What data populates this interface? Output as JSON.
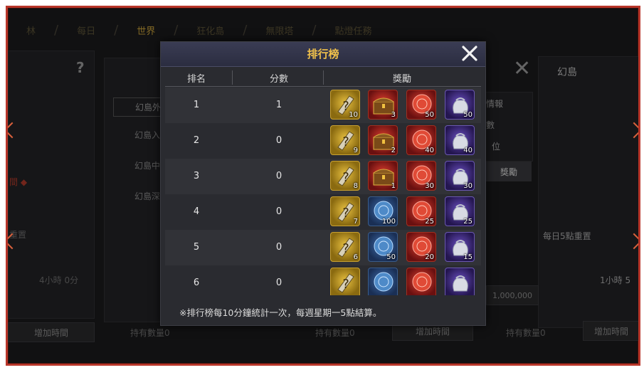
{
  "nav": {
    "tabs": [
      "林",
      "每日",
      "世界",
      "狂化島",
      "無限塔",
      "點燈任務"
    ],
    "active_index": 2
  },
  "background": {
    "left_help": "?",
    "left_label_red": "間 ◆",
    "left_reset": "重置",
    "left_time": "4小時 0分",
    "left_add_time": "增加時間",
    "island_list": [
      "幻島外",
      "幻島入",
      "幻島中",
      "幻島深"
    ],
    "hold_count_1": "持有數量0",
    "hold_count_2": "持有數量0",
    "hold_count_3": "持有數量0",
    "add_time_2": "增加時間",
    "add_time_3": "增加時間",
    "info_title": "情報",
    "info_line1": "數",
    "info_line2": "位",
    "reward_btn": "獎勵",
    "right_title": "幻島",
    "right_reset": "每日5點重置",
    "right_time": "1小時 5",
    "cost": "1,000,000",
    "right_add_time": "增加時間"
  },
  "modal": {
    "title": "排行榜",
    "columns": {
      "rank": "排名",
      "score": "分數",
      "reward": "獎勵"
    },
    "rows": [
      {
        "rank": "1",
        "score": "1",
        "rewards": [
          {
            "icon": "gold-scroll-icon",
            "count": "10"
          },
          {
            "icon": "treasure-chest-icon",
            "count": "3"
          },
          {
            "icon": "red-coin-icon",
            "count": "50"
          },
          {
            "icon": "silver-bag-icon",
            "count": "50"
          }
        ]
      },
      {
        "rank": "2",
        "score": "0",
        "rewards": [
          {
            "icon": "gold-scroll-icon",
            "count": "9"
          },
          {
            "icon": "treasure-chest-icon",
            "count": "2"
          },
          {
            "icon": "red-coin-icon",
            "count": "40"
          },
          {
            "icon": "silver-bag-icon",
            "count": "40"
          }
        ]
      },
      {
        "rank": "3",
        "score": "0",
        "rewards": [
          {
            "icon": "gold-scroll-icon",
            "count": "8"
          },
          {
            "icon": "treasure-chest-icon",
            "count": "1"
          },
          {
            "icon": "red-coin-icon",
            "count": "30"
          },
          {
            "icon": "silver-bag-icon",
            "count": "30"
          }
        ]
      },
      {
        "rank": "4",
        "score": "0",
        "rewards": [
          {
            "icon": "gold-scroll-icon",
            "count": "7"
          },
          {
            "icon": "blue-coin-icon",
            "count": "100"
          },
          {
            "icon": "red-coin-icon",
            "count": "25"
          },
          {
            "icon": "silver-bag-icon",
            "count": "25"
          }
        ]
      },
      {
        "rank": "5",
        "score": "0",
        "rewards": [
          {
            "icon": "gold-scroll-icon",
            "count": "6"
          },
          {
            "icon": "blue-coin-icon",
            "count": "50"
          },
          {
            "icon": "red-coin-icon",
            "count": "20"
          },
          {
            "icon": "silver-bag-icon",
            "count": "15"
          }
        ]
      },
      {
        "rank": "6",
        "score": "0",
        "rewards": [
          {
            "icon": "gold-scroll-icon",
            "count": ""
          },
          {
            "icon": "blue-coin-icon",
            "count": ""
          },
          {
            "icon": "red-coin-icon",
            "count": ""
          },
          {
            "icon": "silver-bag-icon",
            "count": ""
          }
        ]
      }
    ],
    "note": "※排行榜每10分鐘統計一次，每週星期一5點結算。"
  },
  "colors": {
    "frame": "#b8362a",
    "title": "#f0c14b",
    "active_tab": "#c9a23a"
  }
}
